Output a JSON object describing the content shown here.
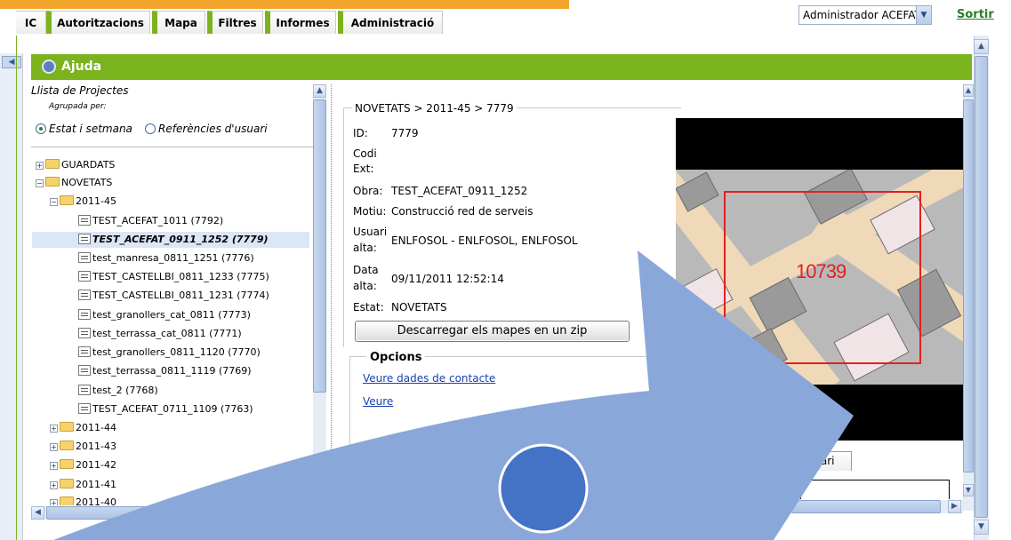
{
  "nav": {
    "tabs": [
      {
        "label": "IC"
      },
      {
        "label": "Autoritzacions"
      },
      {
        "label": "Mapa"
      },
      {
        "label": "Filtres"
      },
      {
        "label": "Informes"
      },
      {
        "label": "Administració"
      }
    ],
    "user": "Administrador ACEFAT",
    "logout": "Sortir"
  },
  "help": {
    "title": "Ajuda"
  },
  "project_list": {
    "title": "Llista de Projectes",
    "group_label": "Agrupada per:",
    "group_options": [
      {
        "label": "Estat i setmana",
        "checked": true
      },
      {
        "label": "Referències d'usuari",
        "checked": false
      }
    ],
    "tree": {
      "folders_top": [
        {
          "label": "GUARDATS",
          "expanded": false
        },
        {
          "label": "NOVETATS",
          "expanded": true
        }
      ],
      "week_open": {
        "label": "2011-45"
      },
      "items": [
        {
          "label": "TEST_ACEFAT_1011 (7792)"
        },
        {
          "label": "TEST_ACEFAT_0911_1252 (7779)",
          "selected": true
        },
        {
          "label": "test_manresa_0811_1251 (7776)"
        },
        {
          "label": "TEST_CASTELLBI_0811_1233 (7775)"
        },
        {
          "label": "TEST_CASTELLBI_0811_1231 (7774)"
        },
        {
          "label": "test_granollers_cat_0811 (7773)"
        },
        {
          "label": "test_terrassa_cat_0811 (7771)"
        },
        {
          "label": "test_granollers_0811_1120 (7770)"
        },
        {
          "label": "test_terrassa_0811_1119 (7769)"
        },
        {
          "label": "test_2 (7768)"
        },
        {
          "label": "TEST_ACEFAT_0711_1109 (7763)"
        }
      ],
      "weeks_closed": [
        {
          "label": "2011-44"
        },
        {
          "label": "2011-43"
        },
        {
          "label": "2011-42"
        },
        {
          "label": "2011-41"
        },
        {
          "label": "2011-40"
        }
      ]
    }
  },
  "detail": {
    "breadcrumb": "NOVETATS > 2011-45 > 7779",
    "fields": {
      "id_label": "ID:",
      "id_value": "7779",
      "codi_label_1": "Codi",
      "codi_label_2": "Ext:",
      "obra_label": "Obra:",
      "obra_value": "TEST_ACEFAT_0911_1252",
      "motiu_label": "Motiu:",
      "motiu_value": "Construcció red de serveis",
      "usuari_label_1": "Usuari",
      "usuari_label_2": "alta:",
      "usuari_value": "ENLFOSOL - ENLFOSOL, ENLFOSOL",
      "data_label_1": "Data",
      "data_label_2": "alta:",
      "data_value": "09/11/2011 12:52:14",
      "estat_label": "Estat:",
      "estat_value": "NOVETATS"
    },
    "download_button": "Descarregar els mapes en un zip",
    "options_title": "Opcions",
    "options_links": [
      {
        "label": "Veure dades de contacte"
      },
      {
        "label": "Veure"
      }
    ],
    "map_label": "10739",
    "user_tab_fragment": "suari"
  },
  "colors": {
    "brand_green": "#7bb31f",
    "brand_orange": "#f1a52b",
    "overlay_arrow": "#8aa7d9",
    "overlay_circle": "#4472c4"
  }
}
